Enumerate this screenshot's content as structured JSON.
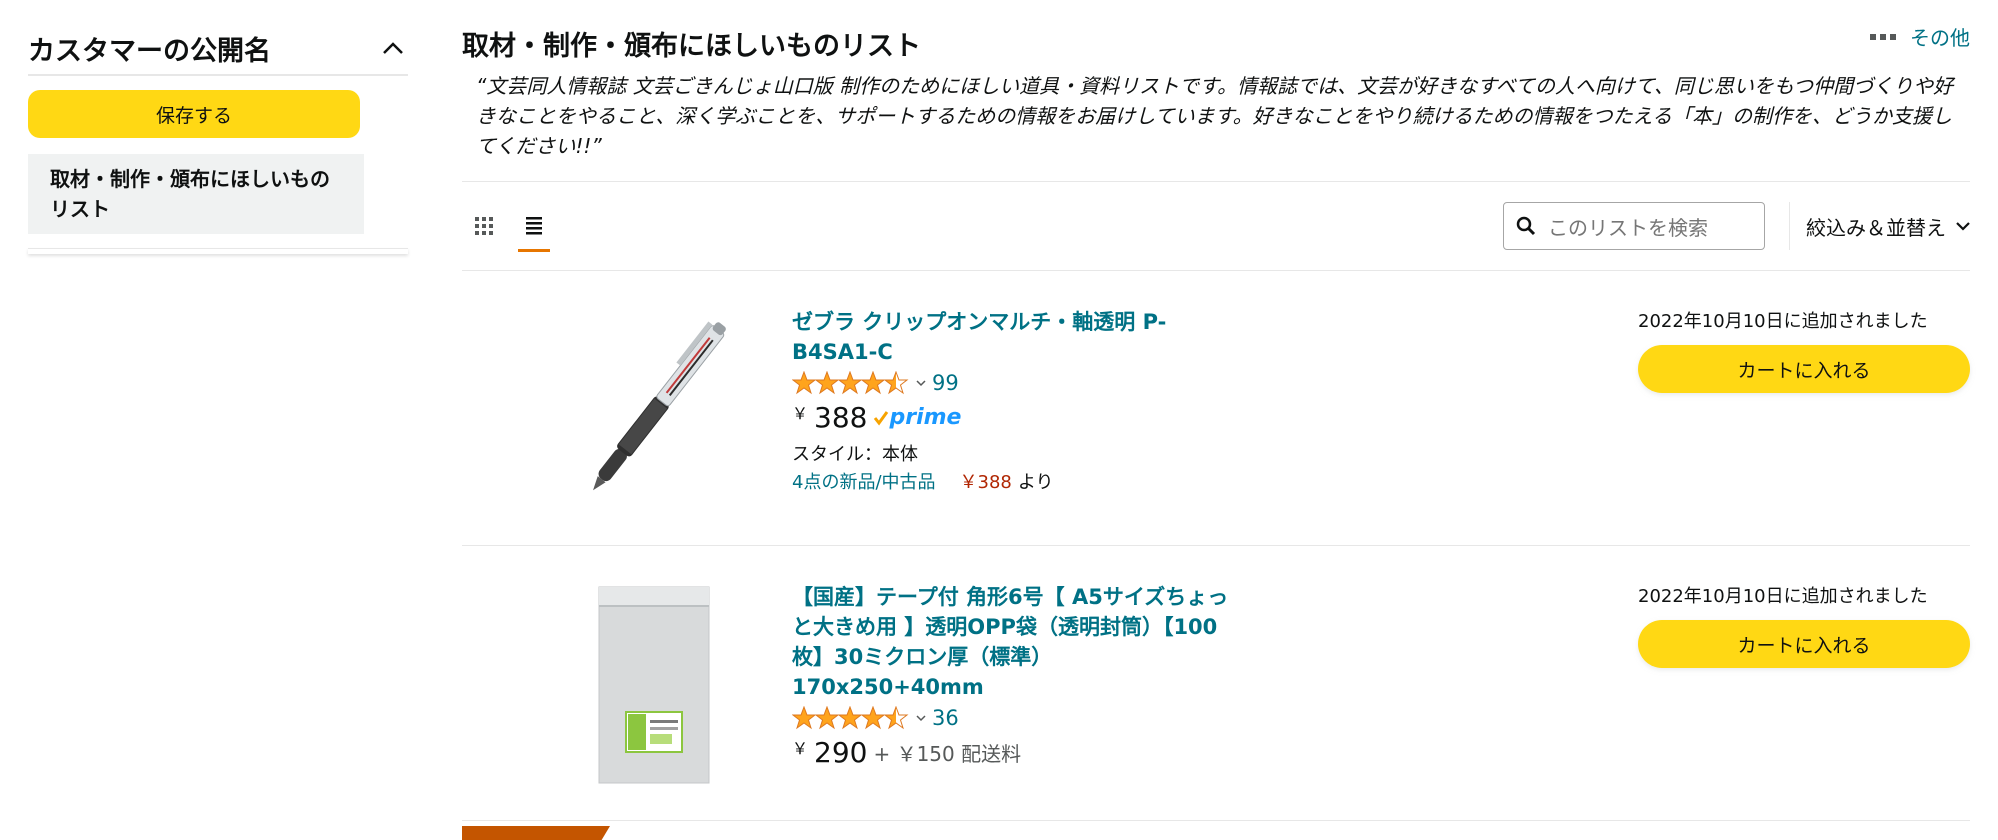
{
  "sidebar": {
    "title": "カスタマーの公開名",
    "save_label": "保存する",
    "list_name": "取材・制作・頒布にほしいものリスト"
  },
  "header": {
    "title": "取材・制作・頒布にほしいものリスト",
    "more_label": "その他",
    "description": "“文芸同人情報誌 文芸ごきんじょ山口版 制作のためにほしい道具・資料リストです。情報誌では、文芸が好きなすべての人へ向けて、同じ思いをもつ仲間づくりや好きなことをやること、深く学ぶことを、サポートするための情報をお届けしています。好きなことをやり続けるための情報をつたえる「本」の制作を、どうか支援してください!!”"
  },
  "toolbar": {
    "search_placeholder": "このリストを検索",
    "sort_label": "絞込み＆並替え"
  },
  "items": [
    {
      "title": "ゼブラ クリップオンマルチ・軸透明 P-B4SA1-C",
      "rating": 4.5,
      "review_count": "99",
      "yen": "￥",
      "price": "388",
      "prime": "prime",
      "style": "スタイル：本体",
      "offers": "4点の新品/中古品",
      "offer_price": "￥388",
      "offer_suffix": "より",
      "added": "2022年10月10日に追加されました",
      "cart_label": "カートに入れる"
    },
    {
      "title": "【国産】テープ付 角形6号【 A5サイズちょっと大きめ用 】透明OPP袋（透明封筒）【100枚】30ミクロン厚（標準） 170x250+40mm",
      "rating": 4.5,
      "review_count": "36",
      "yen": "￥",
      "price": "290",
      "shipping": "+ ￥150 配送料",
      "added": "2022年10月10日に追加されました",
      "cart_label": "カートに入れる"
    }
  ],
  "colors": {
    "button_yellow": "#ffd814",
    "link_teal": "#007185",
    "star_orange": "#ffa41c",
    "prime_blue": "#1a98ff",
    "price_red": "#b12704",
    "tab_orange": "#e77600",
    "badge_orange": "#c45500"
  }
}
